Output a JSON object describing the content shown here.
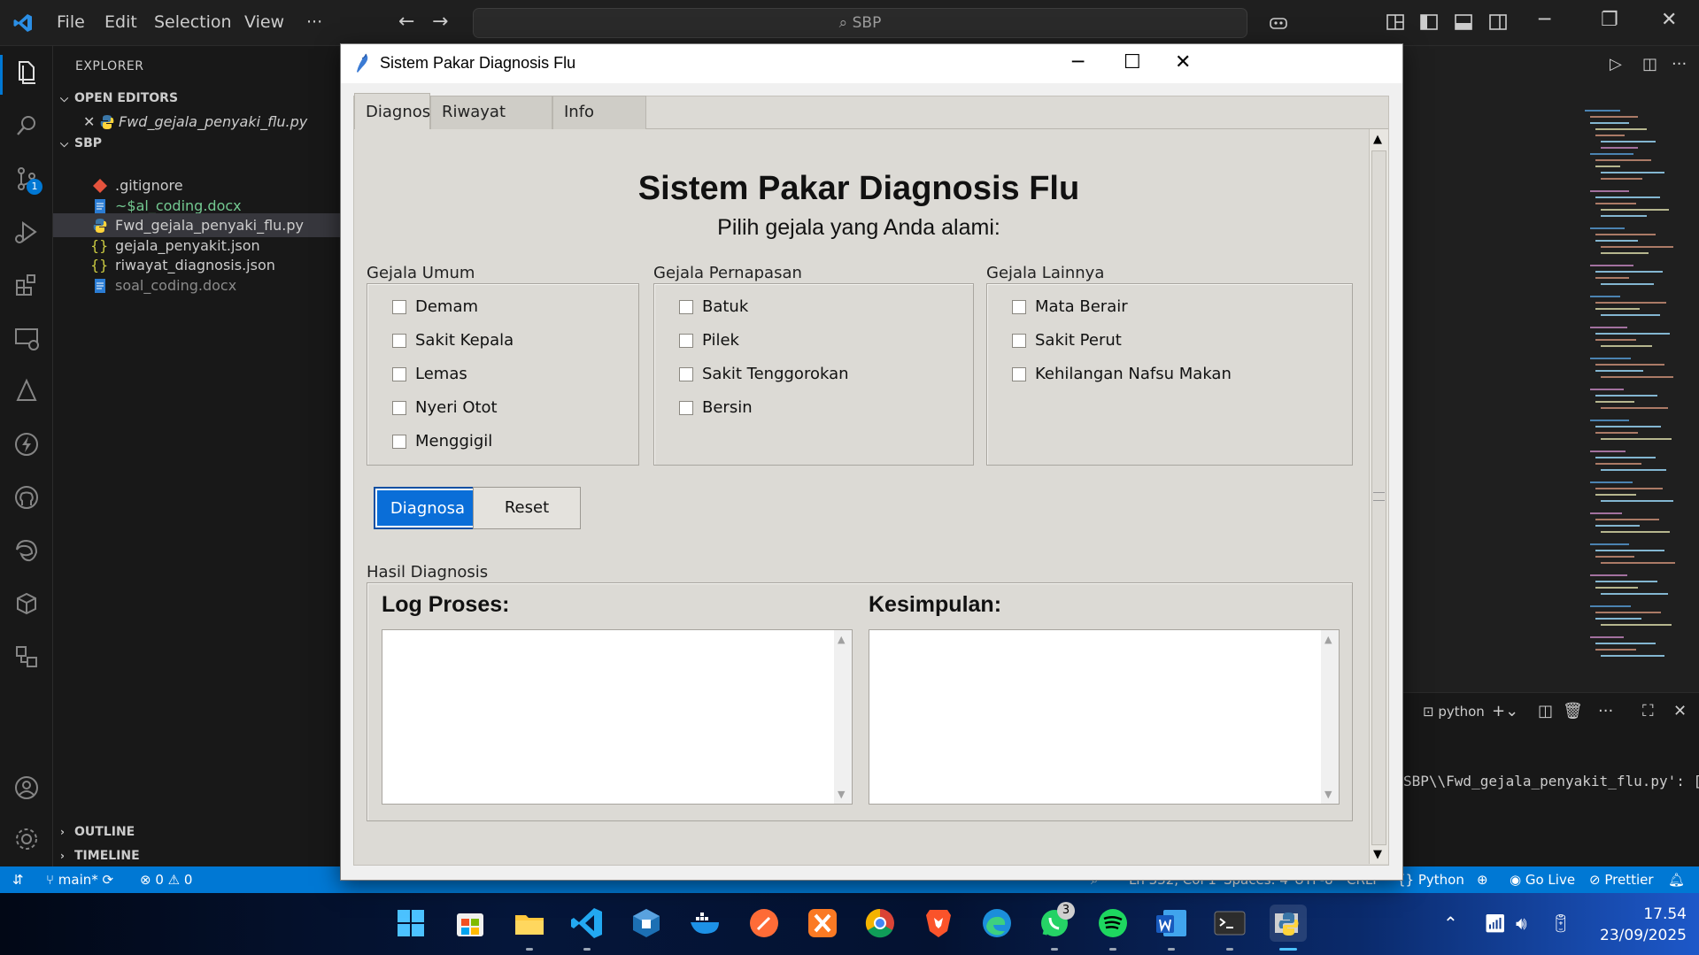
{
  "vscode": {
    "menu": [
      "File",
      "Edit",
      "Selection",
      "View",
      "···"
    ],
    "search_text": "SBP",
    "explorer_title": "EXPLORER",
    "open_editors_label": "OPEN EDITORS",
    "open_editor_file": "Fwd_gejala_penyaki_flu.py",
    "workspace_label": "SBP",
    "files": [
      {
        "name": ".gitignore",
        "color": "#cccccc"
      },
      {
        "name": "~$al_coding.docx",
        "color": "#73c991"
      },
      {
        "name": "Fwd_gejala_penyaki_flu.py",
        "color": "#cccccc"
      },
      {
        "name": "gejala_penyakit.json",
        "color": "#cccccc"
      },
      {
        "name": "riwayat_diagnosis.json",
        "color": "#cccccc"
      },
      {
        "name": "soal_coding.docx",
        "color": "#8b8b8b"
      }
    ],
    "outline_label": "OUTLINE",
    "timeline_label": "TIMELINE",
    "scm_badge": "1",
    "panel": {
      "terminal_label": "python",
      "terminal_line": "SBP\\\\Fwd_gejala_penyakit_flu.py': ["
    },
    "status": {
      "branch": "main*",
      "problems": "⊗ 0 ⚠ 0",
      "cursor": "Ln 332, Col 1",
      "spaces": "Spaces: 4",
      "encoding": "UTF-8",
      "eol": "CRLF",
      "language": "Python",
      "go_live": "Go Live",
      "prettier": "Prettier"
    }
  },
  "taskbar": {
    "time": "17.54",
    "date": "23/09/2025",
    "whatsapp_badge": "3"
  },
  "app": {
    "window_title": "Sistem Pakar Diagnosis Flu",
    "tabs": [
      "Diagnosis",
      "Riwayat Diagnosis",
      "Info Penyakit"
    ],
    "heading": "Sistem Pakar Diagnosis Flu",
    "subheading": "Pilih gejala yang Anda alami:",
    "groups": [
      {
        "label": "Gejala Umum",
        "items": [
          "Demam",
          "Sakit Kepala",
          "Lemas",
          "Nyeri Otot",
          "Menggigil"
        ]
      },
      {
        "label": "Gejala Pernapasan",
        "items": [
          "Batuk",
          "Pilek",
          "Sakit Tenggorokan",
          "Bersin"
        ]
      },
      {
        "label": "Gejala Lainnya",
        "items": [
          "Mata Berair",
          "Sakit Perut",
          "Kehilangan Nafsu Makan"
        ]
      }
    ],
    "diagnose_button": "Diagnosa",
    "reset_button": "Reset",
    "result_label": "Hasil Diagnosis",
    "log_title": "Log Proses:",
    "conclusion_title": "Kesimpulan:"
  },
  "colors": {
    "vscode_accent": "#0078d4",
    "primary_button": "#0a6ed8"
  }
}
